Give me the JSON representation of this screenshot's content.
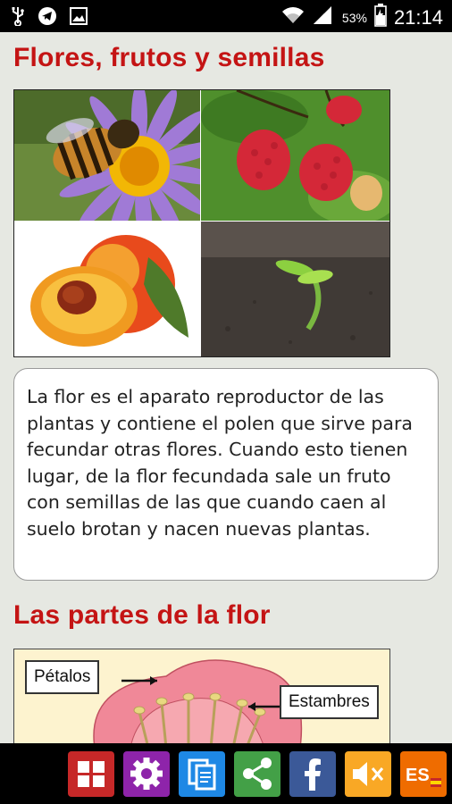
{
  "status_bar": {
    "battery_percent": "53%",
    "time": "21:14",
    "icons": [
      "usb-icon",
      "telegram-icon",
      "image-icon",
      "wifi-icon",
      "signal-icon",
      "battery-icon"
    ]
  },
  "section1": {
    "title": "Flores, frutos y semillas",
    "images": [
      "bee-on-flower",
      "raspberries",
      "peach",
      "seedling"
    ],
    "paragraph": "La flor es el aparato reproductor de las plantas y contiene el polen que sirve para fecundar otras flores. Cuando esto tienen lugar, de la flor fecundada sale un fruto con semillas de las que cuando caen al suelo brotan y nacen nuevas plantas."
  },
  "section2": {
    "title": "Las partes de la flor",
    "labels": {
      "petals": "Pétalos",
      "stamens": "Estambres"
    }
  },
  "bottom_bar": {
    "buttons": [
      {
        "icon": "grid-icon",
        "color": "#c62828"
      },
      {
        "icon": "gear-icon",
        "color": "#8e24aa"
      },
      {
        "icon": "clipboard-icon",
        "color": "#1e88e5"
      },
      {
        "icon": "share-icon",
        "color": "#43a047"
      },
      {
        "icon": "facebook-icon",
        "color": "#3b5998"
      },
      {
        "icon": "speaker-mute-icon",
        "color": "#f9a825"
      },
      {
        "icon": "language-icon",
        "color": "#ef6c00",
        "label": "ES"
      }
    ]
  },
  "colors": {
    "heading": "#c41414",
    "background": "#e6e8e2"
  }
}
